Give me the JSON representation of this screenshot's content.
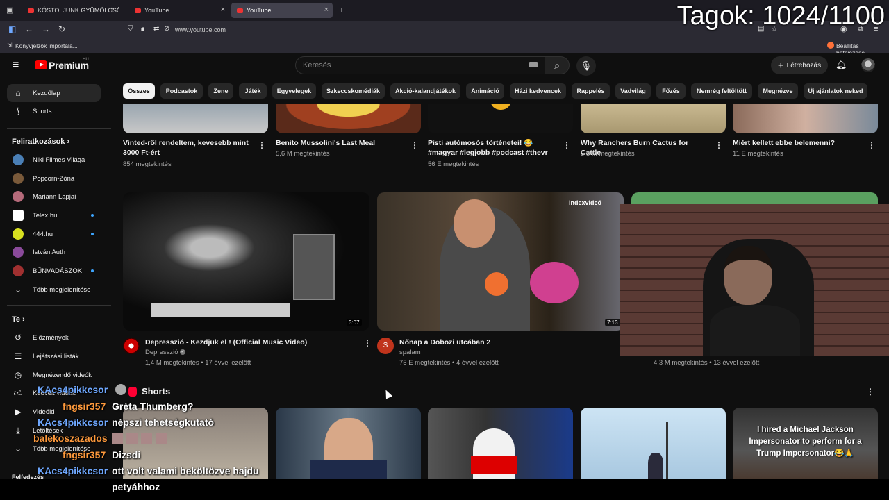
{
  "browser": {
    "tabs": [
      {
        "title": "KÓSTOLJUNK GYÜMÖLCSÖKT | "
      },
      {
        "title": "YouTube"
      },
      {
        "title": "YouTube"
      }
    ],
    "url": "www.youtube.com",
    "bookmarks_import": "Könyvjelzők importálá...",
    "settings_finish": "Beállítás befejezése"
  },
  "overlay": {
    "member_counter": "Tagok: 1024/1100"
  },
  "header": {
    "logo": "Premium",
    "logo_region": "HU",
    "search_placeholder": "Keresés",
    "create_label": "Létrehozás"
  },
  "sidebar": {
    "main": [
      {
        "label": "Kezdőlap"
      },
      {
        "label": "Shorts"
      }
    ],
    "subs_heading": "Feliratkozások",
    "subscriptions": [
      {
        "label": "Niki Filmes Világa"
      },
      {
        "label": "Popcorn-Zóna"
      },
      {
        "label": "Mariann Lapjai"
      },
      {
        "label": "Telex.hu"
      },
      {
        "label": "444.hu"
      },
      {
        "label": "István Auth"
      },
      {
        "label": "BŰNVADÁSZOK"
      }
    ],
    "more_subs": "Több megjelenítése",
    "you_heading": "Te",
    "you_items": [
      {
        "label": "Előzmények"
      },
      {
        "label": "Lejátszási listák"
      },
      {
        "label": "Megnézendő videók"
      },
      {
        "label": "Kedvelt videók"
      },
      {
        "label": "Videóid"
      },
      {
        "label": "Letöltések"
      },
      {
        "label": "Több megjelenítése"
      }
    ],
    "explore_heading": "Felfedezés"
  },
  "chips": [
    "Összes",
    "Podcastok",
    "Zene",
    "Játék",
    "Egyvelegek",
    "Szkeccskomédiák",
    "Akció-kalandjátékok",
    "Animáció",
    "Házi kedvencek",
    "Rappelés",
    "Vadvilág",
    "Főzés",
    "Nemrég feltöltött",
    "Megnézve",
    "Új ajánlatok neked"
  ],
  "row1": [
    {
      "title": "Vinted-ről rendeltem, kevesebb mint 3000 Ft-ért",
      "views": "854 megtekintés"
    },
    {
      "title": "Benito Mussolini's Last Meal",
      "views": "5,6 M megtekintés"
    },
    {
      "title": "Pisti autómosós történetei! 😂 #magyar #legjobb #podcast #thevr",
      "views": "56 E megtekintés"
    },
    {
      "title": "Why Ranchers Burn Cactus for Cattle",
      "views": "5,8 M megtekintés"
    },
    {
      "title": "Miért kellett ebbe belemenni?",
      "views": "11 E megtekintés"
    }
  ],
  "row2": [
    {
      "title": "Depresszió - Kezdjük el ! (Official Music Video)",
      "channel": "Depresszió",
      "meta": "1,4 M megtekintés • 17 évvel ezelőtt",
      "duration": "3:07"
    },
    {
      "title": "Nőnap a Dobozi utcában 2",
      "channel": "spalam",
      "channel_initial": "S",
      "meta": "75 E megtekintés • 4 évvel ezelőtt",
      "duration": "7:13",
      "brand": "indexvideó"
    },
    {
      "meta": "4,3 M megtekintés • 13 évvel ezelőtt"
    }
  ],
  "shorts": {
    "heading": "Shorts",
    "items": [
      {
        "caption": ""
      },
      {
        "caption": ""
      },
      {
        "caption": ""
      },
      {
        "caption": ""
      },
      {
        "caption": "I hired a Michael Jackson Impersonator to perform for a Trump Impersonator😂🙏"
      }
    ]
  },
  "chat": [
    {
      "user": "KAcs4pikkcsor",
      "message": "",
      "color": "#6fa8ff"
    },
    {
      "user": "fngsir357",
      "message": "Gréta Thumberg?",
      "color": "#ff9a3c"
    },
    {
      "user": "KAcs4pikkcsor",
      "message": "népszi tehetségkutató",
      "color": "#6fa8ff"
    },
    {
      "user": "balekoszazados",
      "message": "",
      "color": "#ff9a3c"
    },
    {
      "user": "fngsir357",
      "message": "Dizsdi",
      "color": "#ff9a3c"
    },
    {
      "user": "KAcs4pikkcsor",
      "message": "ott volt valami beköltözve hajdu",
      "color": "#6fa8ff"
    },
    {
      "user": "",
      "message": "petyáhhoz",
      "color": "#fff"
    }
  ]
}
